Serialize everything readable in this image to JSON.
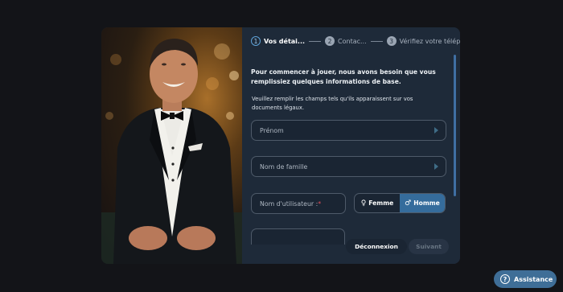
{
  "stepper": {
    "steps": [
      {
        "number": "1",
        "label": "Vos détai..."
      },
      {
        "number": "2",
        "label": "Contac..."
      },
      {
        "number": "3",
        "label": "Vérifiez votre téléph..."
      }
    ]
  },
  "form": {
    "intro": "Pour commencer à jouer, nous avons besoin que vous remplissiez quelques informations de base.",
    "note": "Veuillez remplir les champs tels qu'ils apparaissent sur vos documents légaux.",
    "first_name_placeholder": "Prénom",
    "last_name_placeholder": "Nom de famille",
    "username_placeholder": "Nom d'utilisateur :",
    "required_marker": "*",
    "gender_female": "Femme",
    "gender_male": "Homme",
    "gender_selected": "Homme"
  },
  "actions": {
    "logout_label": "Déconnexion",
    "next_label": "Suivant"
  },
  "assistance": {
    "label": "Assistance",
    "icon": "question-icon"
  },
  "colors": {
    "background": "#131418",
    "panel": "#1e2a39",
    "accent": "#356c9c",
    "assist_button": "#3f6e97"
  }
}
